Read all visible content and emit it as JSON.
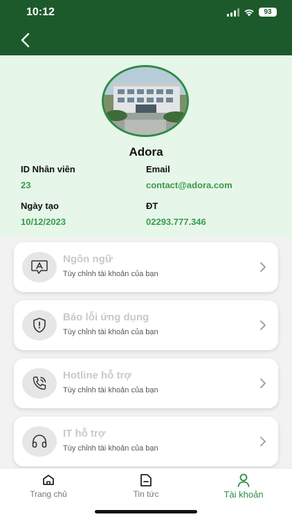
{
  "status_bar": {
    "time": "10:12",
    "battery": "93"
  },
  "profile": {
    "name": "Adora",
    "employee_id_label": "ID Nhân viên",
    "employee_id": "23",
    "email_label": "Email",
    "email": "contact@adora.com",
    "created_label": "Ngày tạo",
    "created": "10/12/2023",
    "phone_label": "ĐT",
    "phone": "02293.777.346"
  },
  "menu": [
    {
      "title": "Ngôn ngữ",
      "subtitle": "Tùy chỉnh tài khoản của bạn",
      "icon": "language-icon"
    },
    {
      "title": "Báo lỗi ứng dụng",
      "subtitle": "Tùy chỉnh tài khoản của bạn",
      "icon": "shield-alert-icon"
    },
    {
      "title": "Hotline hỗ trợ",
      "subtitle": "Tùy chỉnh tài khoản của bạn",
      "icon": "phone-call-icon"
    },
    {
      "title": "IT hỗ trợ",
      "subtitle": "Tùy chỉnh tài khoản của bạn",
      "icon": "headset-icon"
    }
  ],
  "tabs": [
    {
      "label": "Trang chủ",
      "icon": "home-icon"
    },
    {
      "label": "Tin tức",
      "icon": "news-icon"
    },
    {
      "label": "Tài khoản",
      "icon": "user-icon",
      "active": true
    }
  ],
  "colors": {
    "header": "#1d5a2b",
    "accent": "#2e8b45",
    "profile_bg": "#e6f6e9"
  }
}
